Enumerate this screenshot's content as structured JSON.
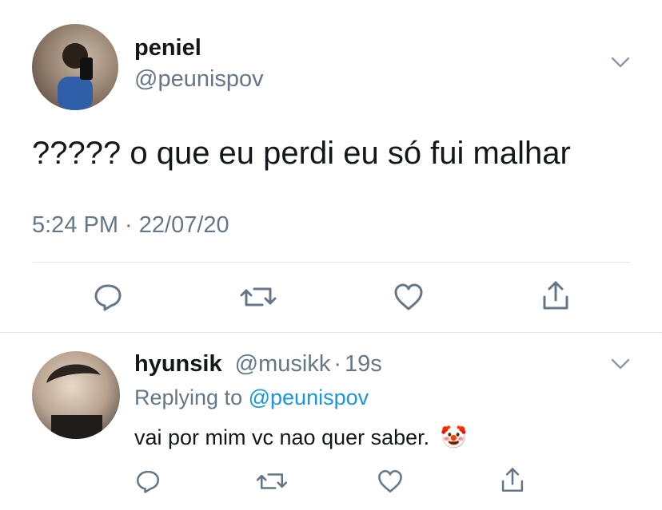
{
  "main_tweet": {
    "author_name": "peniel",
    "author_handle": "@peunispov",
    "text": "????? o que eu perdi eu só fui malhar",
    "timestamp": "5:24 PM · 22/07/20",
    "actions": [
      "reply-icon",
      "retweet-icon",
      "like-icon",
      "share-icon"
    ]
  },
  "reply": {
    "author_name": "hyunsik",
    "author_handle": "@musikk",
    "separator": "·",
    "time": "19s",
    "replying_prefix": "Replying to",
    "replying_handle": "@peunispov",
    "text": "vai por mim vc nao quer saber.",
    "emoji": "🤡"
  },
  "colors": {
    "text": "#14171a",
    "muted": "#657786",
    "link": "#1b95e0",
    "divider": "#e1e8ed",
    "icon": "#657786"
  }
}
